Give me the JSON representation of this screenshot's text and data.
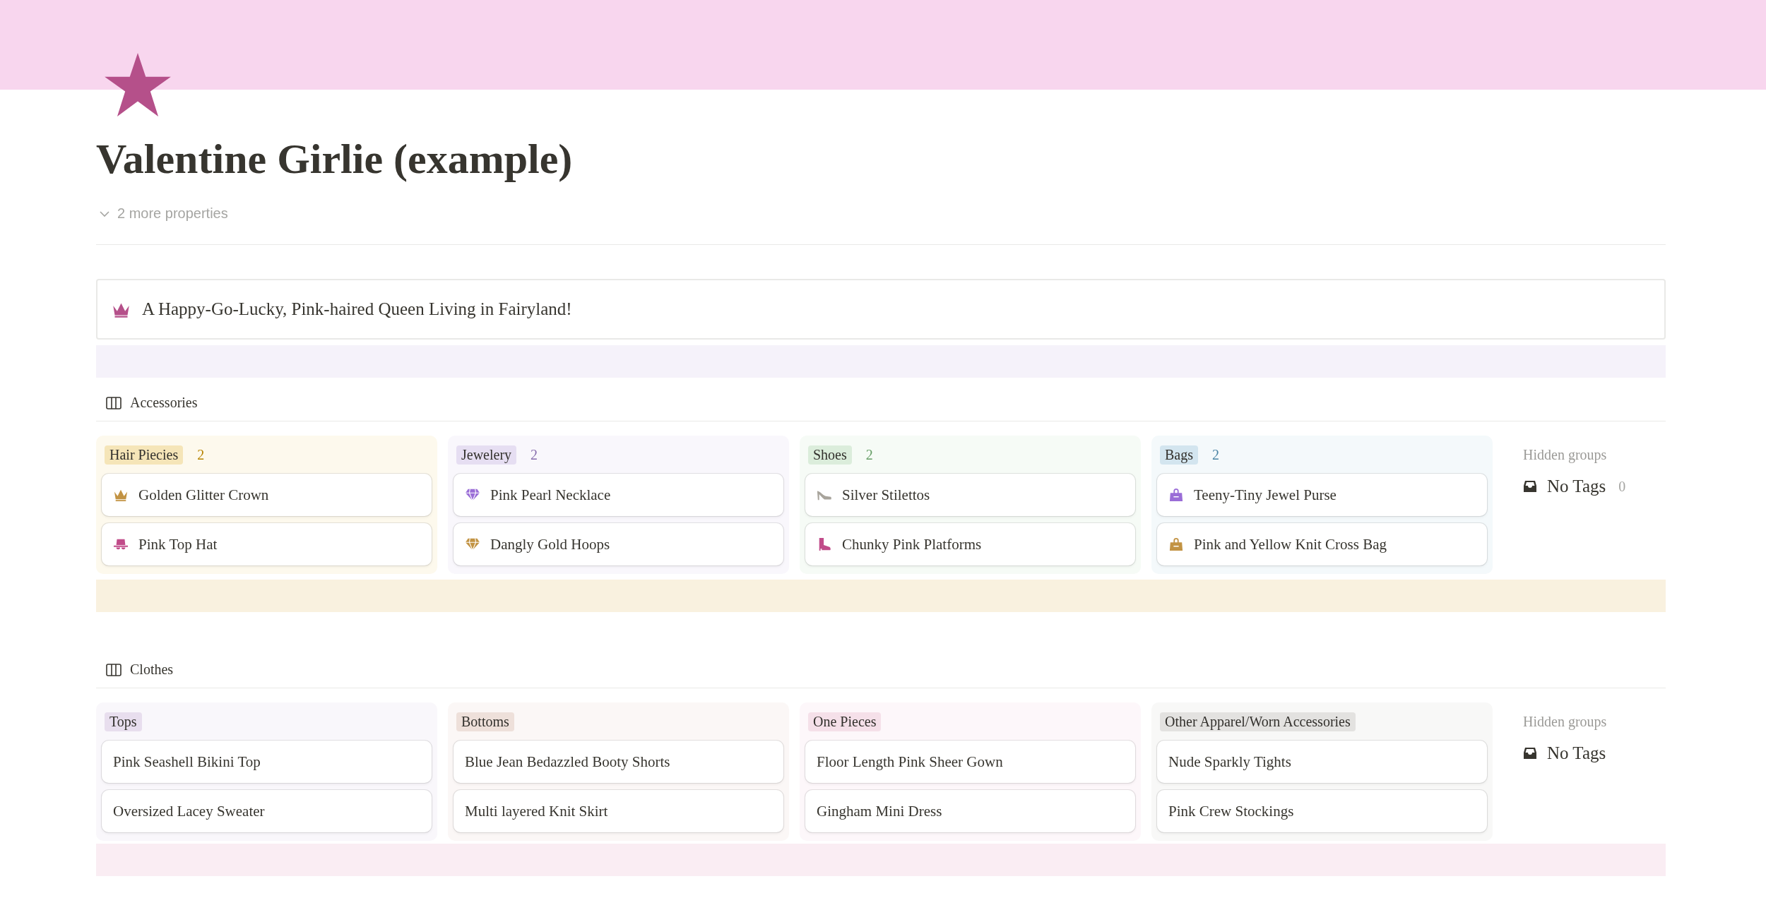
{
  "page": {
    "title": "Valentine Girlie (example)",
    "properties_toggle": "2 more properties"
  },
  "callout": {
    "text": "A Happy-Go-Lucky, Pink-haired Queen Living in Fairyland!"
  },
  "boards": [
    {
      "title": "Accessories",
      "groups": [
        {
          "label": "Hair Piecies",
          "count": "2",
          "color": "#f5e5b8",
          "items": [
            {
              "title": "Golden Glitter Crown",
              "kind": "crown",
              "color": "#c29343"
            },
            {
              "title": "Pink Top Hat",
              "kind": "hat",
              "color": "#c14c8a"
            }
          ]
        },
        {
          "label": "Jewelery",
          "count": "2",
          "color": "#e6def2",
          "items": [
            {
              "title": "Pink Pearl Necklace",
              "kind": "gem",
              "color": "#9a6dd7"
            },
            {
              "title": "Dangly Gold Hoops",
              "kind": "gem",
              "color": "#c29343"
            }
          ]
        },
        {
          "label": "Shoes",
          "count": "2",
          "color": "#dbeddb",
          "items": [
            {
              "title": "Silver Stilettos",
              "kind": "heel",
              "color": "#a8a49c"
            },
            {
              "title": "Chunky Pink Platforms",
              "kind": "boot",
              "color": "#c14c8a"
            }
          ]
        },
        {
          "label": "Bags",
          "count": "2",
          "color": "#d3e5ef",
          "items": [
            {
              "title": "Teeny-Tiny Jewel Purse",
              "kind": "bag",
              "color": "#9a6dd7"
            },
            {
              "title": "Pink and Yellow Knit Cross Bag",
              "kind": "bag",
              "color": "#c29343"
            }
          ]
        }
      ],
      "hidden": {
        "heading": "Hidden groups",
        "label": "No Tags",
        "count": "0"
      }
    },
    {
      "title": "Clothes",
      "groups": [
        {
          "label": "Tops",
          "color": "#e8deee",
          "items": [
            {
              "title": "Pink Seashell Bikini Top"
            },
            {
              "title": "Oversized Lacey Sweater"
            }
          ]
        },
        {
          "label": "Bottoms",
          "color": "#eee0da",
          "items": [
            {
              "title": "Blue Jean Bedazzled Booty Shorts"
            },
            {
              "title": "Multi layered Knit Skirt"
            }
          ]
        },
        {
          "label": "One Pieces",
          "color": "#f5e0e9",
          "items": [
            {
              "title": "Floor Length Pink Sheer Gown"
            },
            {
              "title": "Gingham Mini Dress"
            }
          ]
        },
        {
          "label": "Other Apparel/Worn Accessories",
          "color": "#e3e2e0",
          "items": [
            {
              "title": "Nude Sparkly Tights"
            },
            {
              "title": "Pink Crew Stockings"
            }
          ]
        }
      ],
      "hidden": {
        "heading": "Hidden groups",
        "label": "No Tags"
      }
    }
  ]
}
